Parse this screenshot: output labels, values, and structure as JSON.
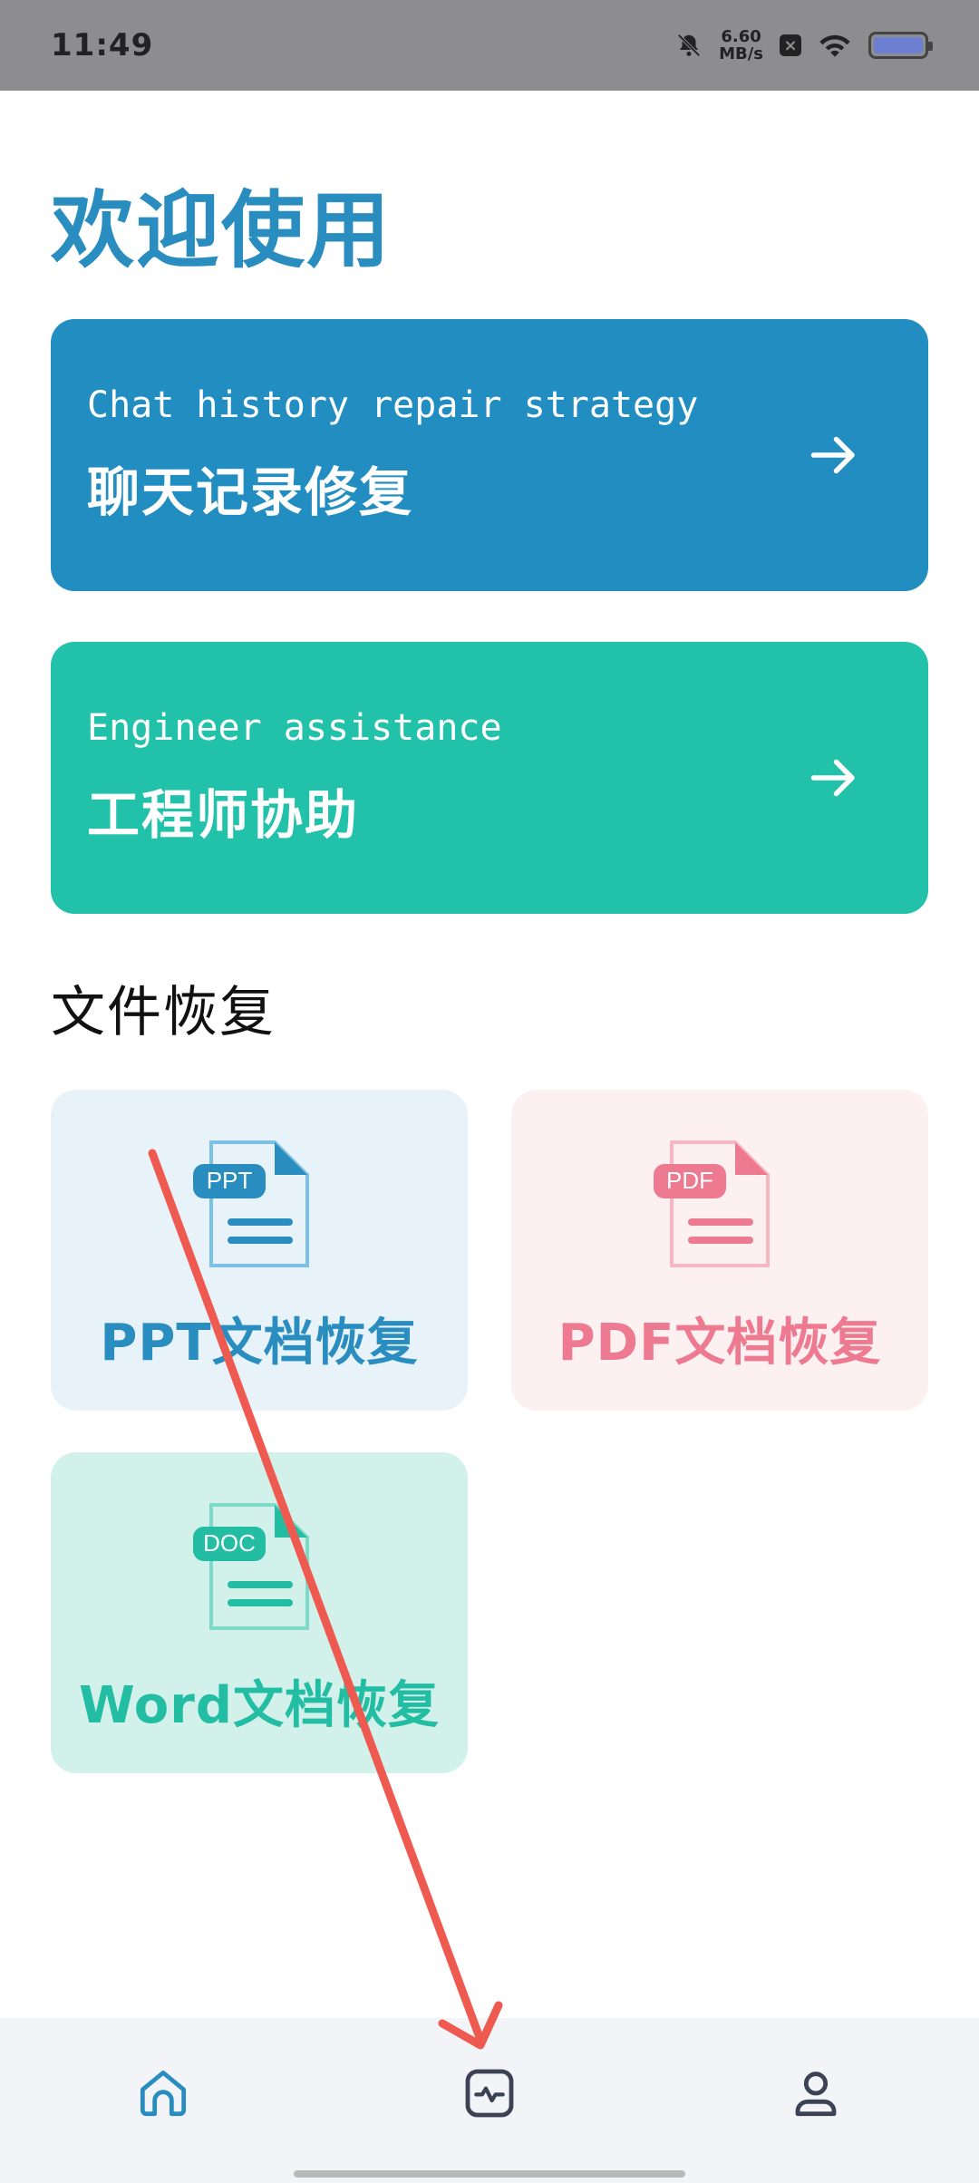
{
  "status_bar": {
    "time": "11:49",
    "speed_value": "6.60",
    "speed_unit": "MB/s"
  },
  "page": {
    "welcome_title": "欢迎使用"
  },
  "cards": {
    "chat": {
      "subtitle": "Chat history repair strategy",
      "title": "聊天记录修复",
      "color": "#228dc1"
    },
    "engineer": {
      "subtitle": "Engineer assistance",
      "title": "工程师协助",
      "color": "#22c1a9"
    }
  },
  "section": {
    "file_recovery_title": "文件恢复"
  },
  "tiles": {
    "ppt": {
      "badge": "PPT",
      "label": "PPT文档恢复",
      "color": "#2a8dbf"
    },
    "pdf": {
      "badge": "PDF",
      "label": "PDF文档恢复",
      "color": "#ee7a92"
    },
    "doc": {
      "badge": "DOC",
      "label": "Word文档恢复",
      "color": "#22bda3"
    }
  },
  "bottom_nav": {
    "items": [
      {
        "icon": "home-icon"
      },
      {
        "icon": "activity-icon"
      },
      {
        "icon": "user-icon"
      }
    ]
  }
}
